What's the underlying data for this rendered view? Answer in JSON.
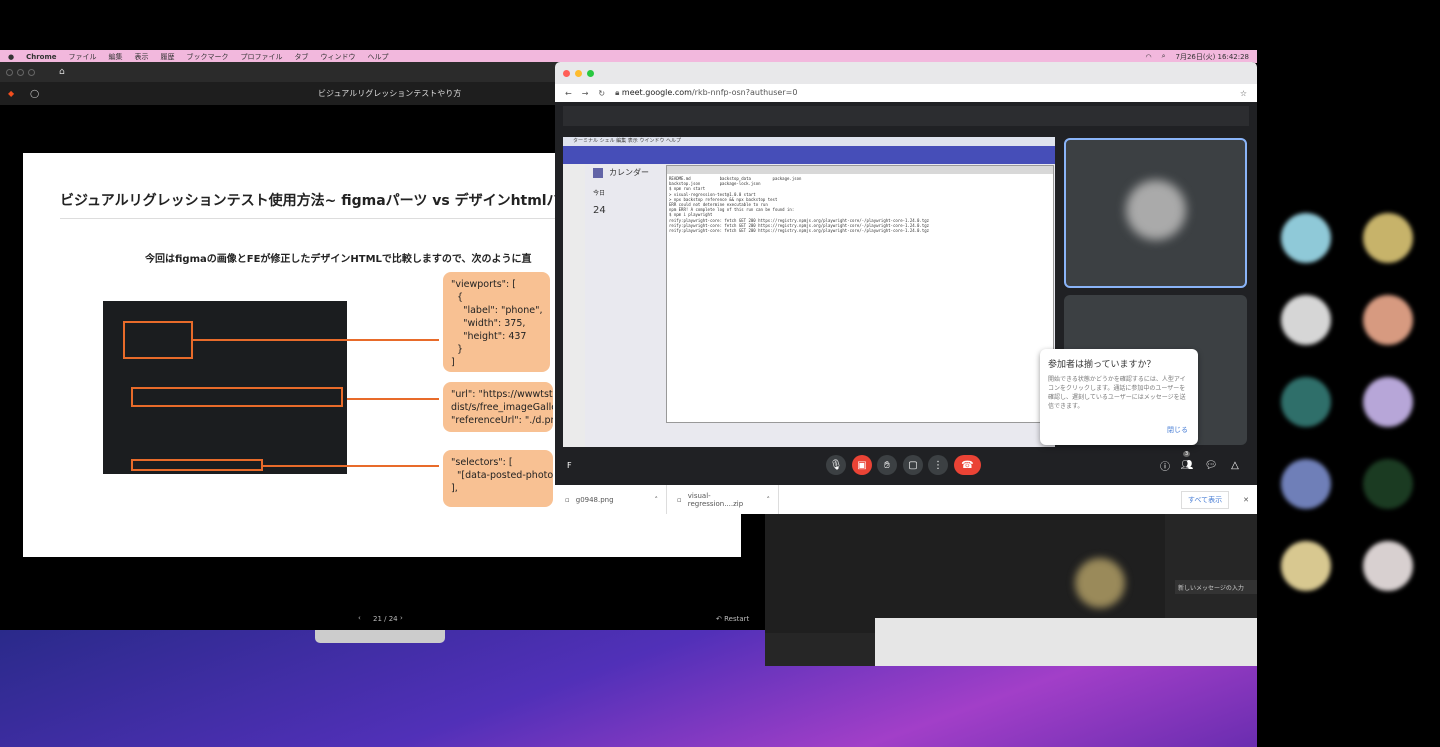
{
  "menubar": {
    "app": "Chrome",
    "items": [
      "ファイル",
      "編集",
      "表示",
      "履歴",
      "ブックマーク",
      "プロファイル",
      "タブ",
      "ウィンドウ",
      "ヘルプ"
    ],
    "clock": "7月26日(火) 16:42:28"
  },
  "presentation": {
    "doc_title": "ビジュアルリグレッションテストやり方",
    "slide": {
      "title": "ビジュアルリグレッションテスト使用方法~ figmaパーツ vs デザインhtmlパ",
      "subtitle": "今回はfigmaの画像とFEが修正したデザインHTMLで比較しますので、次のように直",
      "box1": "\"viewports\": [\n  {\n    \"label\": \"phone\",\n    \"width\": 375,\n    \"height\": 437\n  }\n]",
      "box2": "\"url\": \"https://wwwtst.k4\ndist/s/free_imageGallery_\n\"referenceUrl\": \"./d.pmg\"",
      "box3": "\"selectors\": [\n  \"[data-posted-photo-c\n],"
    },
    "page_indicator": "21 / 24",
    "restart_label": "Restart"
  },
  "meet": {
    "url_host": "meet.google.com",
    "url_path": "/rkb-nnfp-osn?authuser=0",
    "shared_screen": {
      "menubar": "ターミナル  シェル  編集  表示  ウインドウ  ヘルプ",
      "calendar_title": "カレンダー",
      "today": "今日",
      "date": "24",
      "terminal_lines": [
        "README.md            backstop_data         package.json",
        "backstop.json        package-lock.json",
        "$ npm run start",
        "> visual-regression-test@1.0.0 start",
        "> npx backstop reference && npx backstop test",
        "ERR could not determine executable to run",
        "npm ERR! A complete log of this run can be found in:",
        "$ npm i playwright",
        "reify:playwright-core: fetch GET 200 https://registry.npmjs.org/playwright-core/-/playwright-core-1.24.0.tgz",
        "reify:playwright-core: fetch GET 200 https://registry.npmjs.org/playwright-core/-/playwright-core-1.24.0.tgz",
        "reify:playwright-core: fetch GET 200 https://registry.npmjs.org/playwright-core/-/playwright-core-1.24.0.tgz"
      ]
    },
    "popup": {
      "title": "参加者は揃っていますか？",
      "body": "開始できる状態かどうかを確認するには、人型アイコンをクリックします。通話に参加中のユーザーを確認し、遅刻しているユーザーにはメッセージを送信できます。",
      "close": "閉じる"
    },
    "self_initial": "F",
    "participant_count": "3",
    "accent": "#ea4335"
  },
  "downloads": {
    "items": [
      "g0948.png",
      "visual-regression....zip"
    ],
    "show_all": "すべて表示"
  },
  "teams_chat": {
    "placeholder": "新しいメッセージの入力"
  }
}
